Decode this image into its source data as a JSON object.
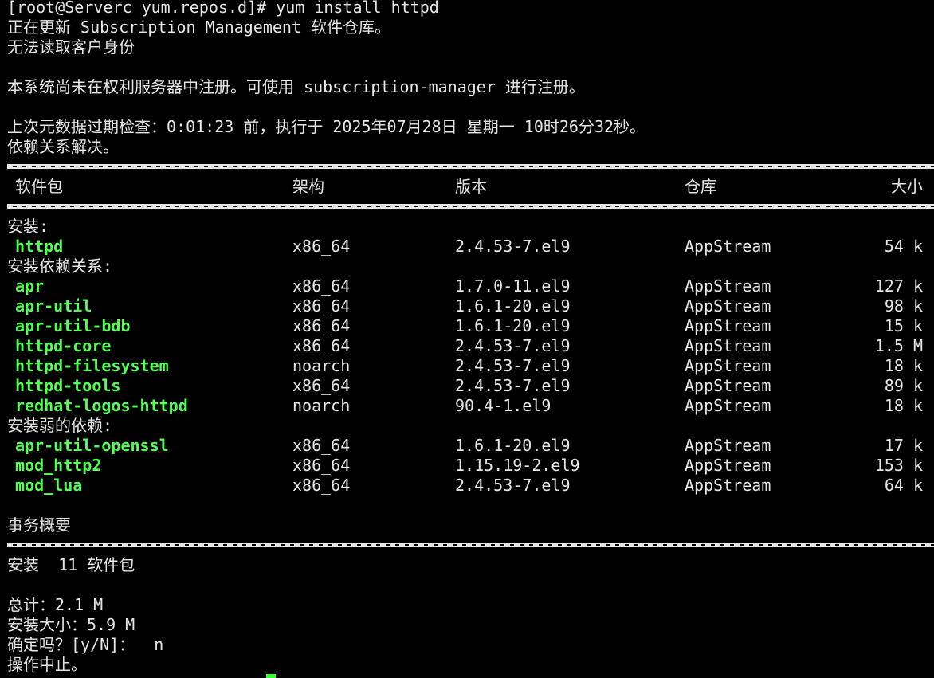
{
  "terminal": {
    "prompt_line": "[root@Serverc yum.repos.d]# yum install httpd",
    "updating": "正在更新 Subscription Management 软件仓库。",
    "no_identity": "无法读取客户身份",
    "not_registered": "本系统尚未在权利服务器中注册。可使用 subscription-manager 进行注册。",
    "metadata_check": "上次元数据过期检查：0:01:23 前，执行于 2025年07月28日 星期一 10时26分32秒。",
    "deps_resolved": "依赖关系解决。",
    "columns": {
      "name": "软件包",
      "arch": "架构",
      "version": "版本",
      "repo": "仓库",
      "size": "大小"
    },
    "section_install": "安装:",
    "section_deps": "安装依赖关系:",
    "section_weak": "安装弱的依赖:",
    "install_packages": [
      {
        "name": "httpd",
        "arch": "x86_64",
        "version": "2.4.53-7.el9",
        "repo": "AppStream",
        "size": "54 k"
      }
    ],
    "dep_packages": [
      {
        "name": "apr",
        "arch": "x86_64",
        "version": "1.7.0-11.el9",
        "repo": "AppStream",
        "size": "127 k"
      },
      {
        "name": "apr-util",
        "arch": "x86_64",
        "version": "1.6.1-20.el9",
        "repo": "AppStream",
        "size": "98 k"
      },
      {
        "name": "apr-util-bdb",
        "arch": "x86_64",
        "version": "1.6.1-20.el9",
        "repo": "AppStream",
        "size": "15 k"
      },
      {
        "name": "httpd-core",
        "arch": "x86_64",
        "version": "2.4.53-7.el9",
        "repo": "AppStream",
        "size": "1.5 M"
      },
      {
        "name": "httpd-filesystem",
        "arch": "noarch",
        "version": "2.4.53-7.el9",
        "repo": "AppStream",
        "size": "18 k"
      },
      {
        "name": "httpd-tools",
        "arch": "x86_64",
        "version": "2.4.53-7.el9",
        "repo": "AppStream",
        "size": "89 k"
      },
      {
        "name": "redhat-logos-httpd",
        "arch": "noarch",
        "version": "90.4-1.el9",
        "repo": "AppStream",
        "size": "18 k"
      }
    ],
    "weak_packages": [
      {
        "name": "apr-util-openssl",
        "arch": "x86_64",
        "version": "1.6.1-20.el9",
        "repo": "AppStream",
        "size": "17 k"
      },
      {
        "name": "mod_http2",
        "arch": "x86_64",
        "version": "1.15.19-2.el9",
        "repo": "AppStream",
        "size": "153 k"
      },
      {
        "name": "mod_lua",
        "arch": "x86_64",
        "version": "2.4.53-7.el9",
        "repo": "AppStream",
        "size": "64 k"
      }
    ],
    "transaction_summary": "事务概要",
    "install_count": "安装  11 软件包",
    "total": "总计：2.1 M",
    "installed_size": "安装大小：5.9 M",
    "confirm_prompt": "确定吗？[y/N]：  n",
    "aborted": "操作中止。"
  },
  "colors": {
    "background": "#000000",
    "text": "#e6e6e6",
    "package_name": "#54ff54",
    "cursor": "#33ff33"
  }
}
